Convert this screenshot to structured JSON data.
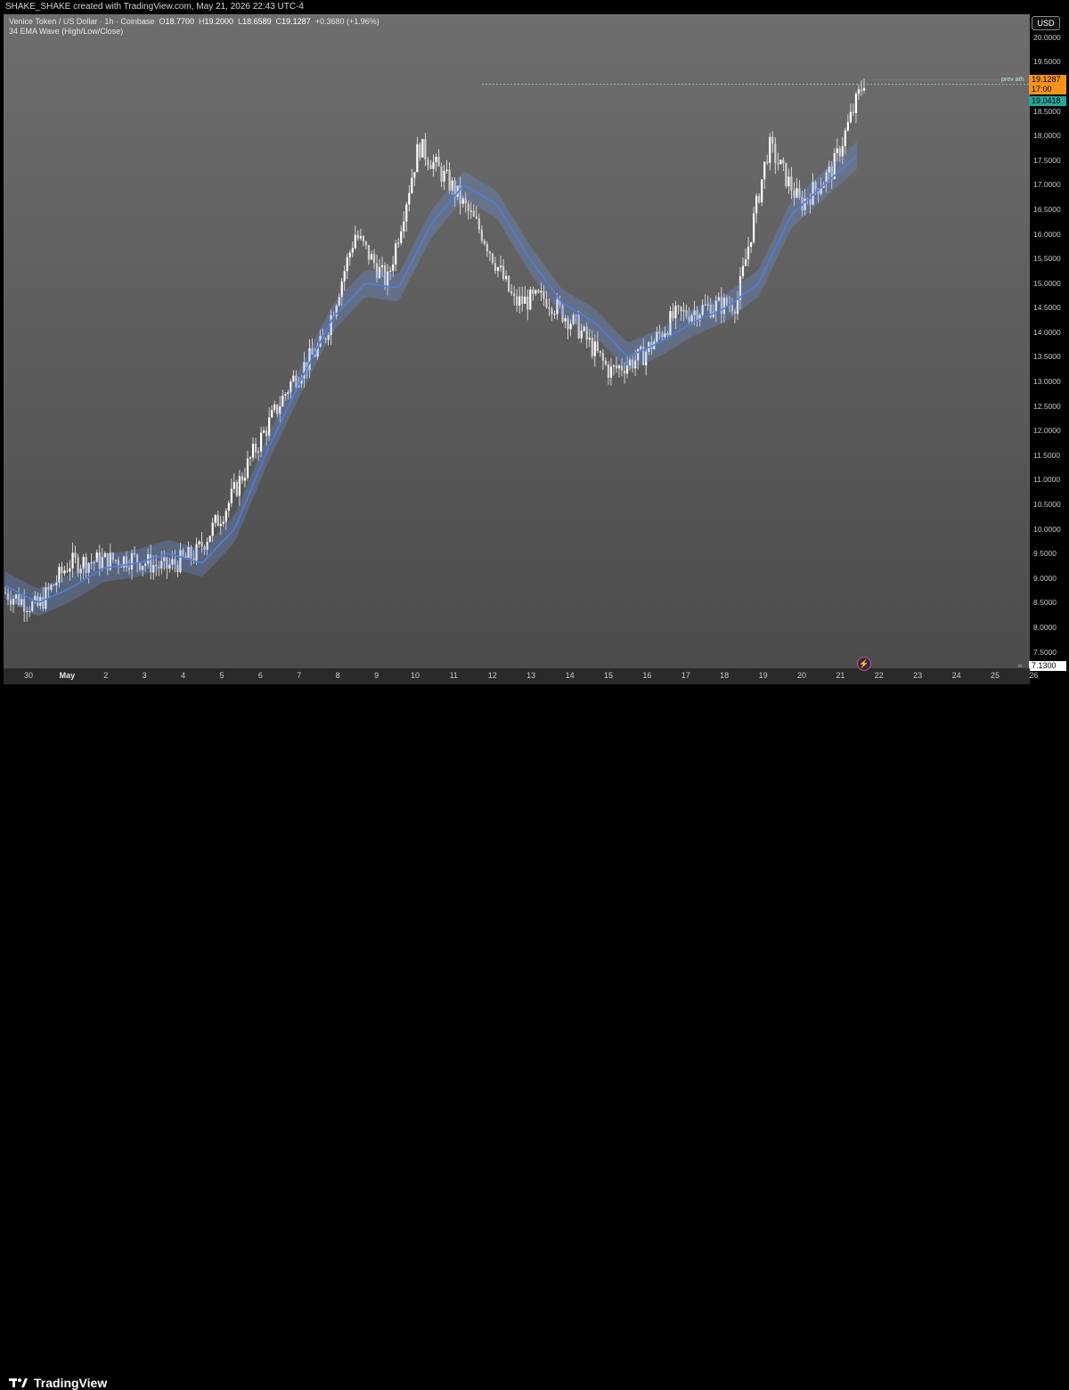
{
  "header": {
    "credit": "SHAKE_SHAKE created with TradingView.com, May 21, 2026 22:43 UTC-4"
  },
  "legend": {
    "symbol": "Venice Token / US Dollar · 1h · Coinbase",
    "open_label": "O",
    "open": "18.7700",
    "high_label": "H",
    "high": "19.2000",
    "low_label": "L",
    "low": "18.6589",
    "close_label": "C",
    "close": "19.1287",
    "change": "+0.3680 (+1.96%)",
    "indicator": "34 EMA Wave (High/Low/Close)"
  },
  "price_axis": {
    "currency": "USD",
    "ticks": [
      "20.0000",
      "19.5000",
      "19.0000",
      "18.5000",
      "18.0000",
      "17.5000",
      "17.0000",
      "16.5000",
      "16.0000",
      "15.5000",
      "15.0000",
      "14.5000",
      "14.0000",
      "13.5000",
      "13.0000",
      "12.5000",
      "12.0000",
      "11.5000",
      "11.0000",
      "10.5000",
      "10.0000",
      "9.5000",
      "9.0000",
      "8.5000",
      "8.0000",
      "7.5000"
    ],
    "last_price": "19.1287",
    "countdown": "17:00",
    "ema_value": "19.0418",
    "bottom_value": "7.1300",
    "bottom_mark": "w"
  },
  "annotation": {
    "label": "prev ath"
  },
  "time_axis": {
    "labels": [
      "30",
      "May",
      "2",
      "3",
      "4",
      "5",
      "6",
      "7",
      "8",
      "9",
      "10",
      "11",
      "12",
      "13",
      "14",
      "15",
      "16",
      "17",
      "18",
      "19",
      "20",
      "21",
      "22",
      "23",
      "24",
      "25",
      "26"
    ]
  },
  "footer": {
    "brand": "TradingView"
  },
  "colors": {
    "background_top": "#6e6e6e",
    "background_bottom": "#4b4b4b",
    "candles": "#ffffff",
    "ema": "#4f7fd9",
    "last_price_tag": "#f7931a",
    "ema_tag": "#26a69a",
    "ath_line": "#7fd6d6"
  },
  "chart_data": {
    "type": "candlestick",
    "title": "Venice Token / US Dollar · 1h · Coinbase",
    "x": [
      "30",
      "May",
      "2",
      "3",
      "4",
      "5",
      "6",
      "7",
      "8",
      "9",
      "10",
      "11",
      "12",
      "13",
      "14",
      "15",
      "16",
      "17",
      "18",
      "19",
      "20",
      "21",
      "22"
    ],
    "close_path": [
      8.7,
      8.4,
      9.3,
      9.35,
      9.4,
      9.2,
      9.5,
      10.5,
      11.8,
      13.0,
      13.8,
      16.0,
      15.0,
      17.8,
      17.0,
      16.0,
      14.6,
      14.7,
      14.1,
      13.2,
      13.5,
      14.3,
      14.5,
      14.6,
      17.8,
      16.6,
      17.3,
      19.13
    ],
    "ema_path": [
      8.85,
      8.5,
      8.8,
      9.2,
      9.3,
      9.5,
      9.3,
      10.0,
      11.6,
      13.0,
      14.3,
      15.0,
      14.9,
      16.2,
      17.0,
      16.6,
      15.5,
      14.6,
      14.2,
      13.5,
      13.8,
      14.2,
      14.5,
      15.0,
      16.4,
      17.0,
      17.6
    ],
    "prev_ath": 19.0418,
    "last": 19.1287,
    "ylim": [
      7.13,
      20.25
    ],
    "series": [
      {
        "name": "Venice Token / US Dollar",
        "values": [
          8.7,
          8.4,
          9.3,
          9.35,
          9.4,
          9.2,
          9.5,
          10.5,
          11.8,
          13.0,
          13.8,
          16.0,
          15.0,
          17.8,
          17.0,
          16.0,
          14.6,
          14.7,
          14.1,
          13.2,
          13.5,
          14.3,
          14.5,
          14.6,
          17.8,
          16.6,
          17.3,
          19.13
        ]
      },
      {
        "name": "34 EMA Wave (High/Low/Close)",
        "values": [
          8.85,
          8.5,
          8.8,
          9.2,
          9.3,
          9.5,
          9.3,
          10.0,
          11.6,
          13.0,
          14.3,
          15.0,
          14.9,
          16.2,
          17.0,
          16.6,
          15.5,
          14.6,
          14.2,
          13.5,
          13.8,
          14.2,
          14.5,
          15.0,
          16.4,
          17.0,
          17.6
        ]
      }
    ]
  }
}
